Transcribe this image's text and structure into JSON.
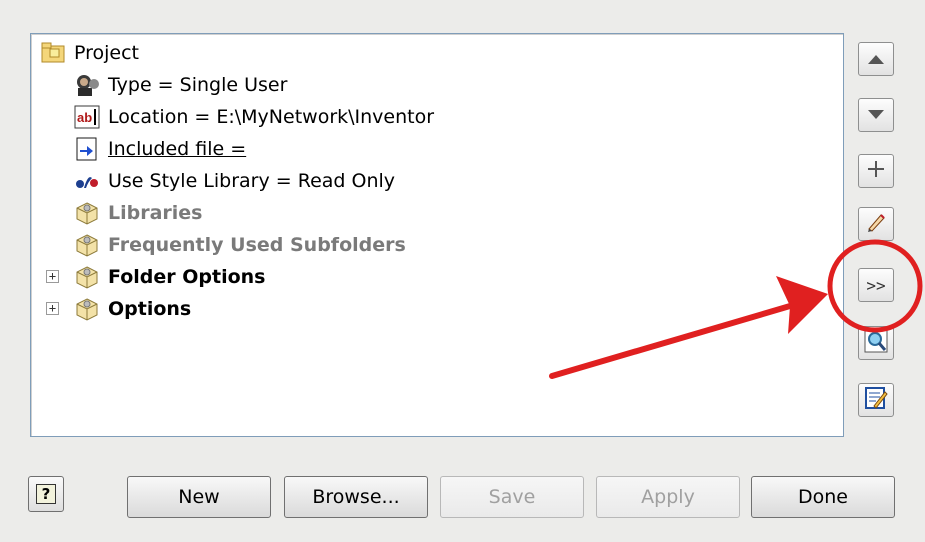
{
  "tree": {
    "root": {
      "label": "Project",
      "icon": "folder-project-icon"
    },
    "items": [
      {
        "label": "Type = Single User",
        "icon": "user-type-icon"
      },
      {
        "label": "Location =  E:\\MyNetwork\\Inventor",
        "icon": "ab-text-icon"
      },
      {
        "label": "Included file = ",
        "icon": "included-file-icon"
      },
      {
        "label": "Use Style Library = Read Only",
        "icon": "style-library-icon"
      },
      {
        "label": "Libraries",
        "icon": "library-box-icon"
      },
      {
        "label": "Frequently Used Subfolders",
        "icon": "library-box-icon"
      },
      {
        "label": "Folder Options",
        "icon": "library-box-icon"
      },
      {
        "label": "Options",
        "icon": "library-box-icon"
      }
    ]
  },
  "side_buttons": {
    "move_up": "move-up-arrow-icon",
    "move_down": "move-down-arrow-icon",
    "add": "plus-icon",
    "edit": "pencil-icon",
    "more_label": ">>",
    "find": "magnifier-icon",
    "edit_file": "edit-document-icon"
  },
  "bottom_buttons": {
    "help": "?",
    "new": "New",
    "browse": "Browse...",
    "save": "Save",
    "apply": "Apply",
    "done": "Done"
  },
  "colors": {
    "annotation": "#e02020"
  }
}
